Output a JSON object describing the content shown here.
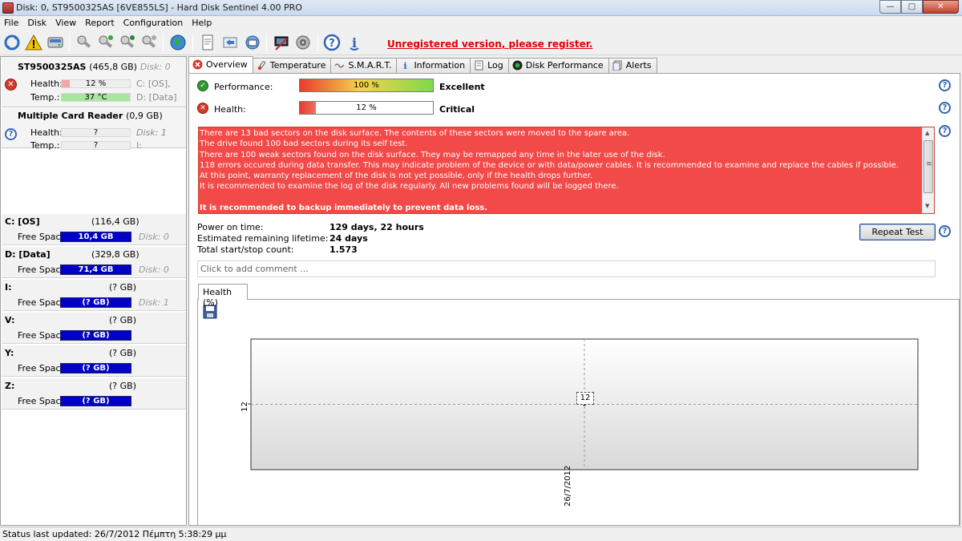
{
  "window": {
    "title": "Disk: 0, ST9500325AS [6VE855LS]  -  Hard Disk Sentinel 4.00 PRO",
    "min_label": "—",
    "max_label": "□",
    "close_label": "✕"
  },
  "menu": [
    "File",
    "Disk",
    "View",
    "Report",
    "Configuration",
    "Help"
  ],
  "toolbar": {
    "register_text": "Unregistered version, please register."
  },
  "disks": [
    {
      "model": "ST9500325AS",
      "size": "(465,8 GB)",
      "disk_no": "Disk: 0",
      "status": "bad",
      "health_label": "Health:",
      "health_value": "12 %",
      "health_fraction": 0.12,
      "health_color": "#f4a6a6",
      "temp_label": "Temp.:",
      "temp_value": "37 °C",
      "temp_color": "#a8e6a0",
      "extra1": "C: [OS],",
      "extra2": "D: [Data]"
    },
    {
      "model": "Multiple Card  Reader",
      "size": "(0,9 GB)",
      "disk_no": "",
      "status": "unknown",
      "health_label": "Health:",
      "health_value": "?",
      "temp_label": "Temp.:",
      "temp_value": "?",
      "extra1": "Disk: 1",
      "extra2": "I:"
    }
  ],
  "volumes": [
    {
      "name": "C: [OS]",
      "size": "(116,4 GB)",
      "free_label": "Free Space",
      "free": "10,4 GB",
      "disk": "Disk: 0",
      "used_fraction": 0.91
    },
    {
      "name": "D: [Data]",
      "size": "(329,8 GB)",
      "free_label": "Free Space",
      "free": "71,4 GB",
      "disk": "Disk: 0",
      "used_fraction": 0.78
    },
    {
      "name": "I:",
      "size": "(? GB)",
      "free_label": "Free Space",
      "free": "(? GB)",
      "disk": "Disk: 1",
      "used_fraction": 1
    },
    {
      "name": "V:",
      "size": "(? GB)",
      "free_label": "Free Space",
      "free": "(? GB)",
      "disk": "",
      "used_fraction": 1
    },
    {
      "name": "Y:",
      "size": "(? GB)",
      "free_label": "Free Space",
      "free": "(? GB)",
      "disk": "",
      "used_fraction": 1
    },
    {
      "name": "Z:",
      "size": "(? GB)",
      "free_label": "Free Space",
      "free": "(? GB)",
      "disk": "",
      "used_fraction": 1
    }
  ],
  "tabs": [
    {
      "label": "Overview",
      "icon": "error-icon",
      "active": true
    },
    {
      "label": "Temperature",
      "icon": "thermometer-icon"
    },
    {
      "label": "S.M.A.R.T.",
      "icon": "smart-icon"
    },
    {
      "label": "Information",
      "icon": "info-icon"
    },
    {
      "label": "Log",
      "icon": "log-icon"
    },
    {
      "label": "Disk Performance",
      "icon": "performance-icon"
    },
    {
      "label": "Alerts",
      "icon": "alerts-icon"
    }
  ],
  "overview": {
    "performance_label": "Performance:",
    "performance_value": "100 %",
    "performance_fraction": 1.0,
    "performance_verdict": "Excellent",
    "health_label": "Health:",
    "health_value": "12 %",
    "health_fraction": 0.12,
    "health_verdict": "Critical",
    "messages": [
      "There are 13 bad sectors on the disk surface. The contents of these sectors were moved to the spare area.",
      "The drive found 100 bad sectors during its self test.",
      "There are 100 weak sectors found on the disk surface. They may be remapped any time in the later use of the disk.",
      "118 errors occured during data transfer. This may indicate problem of the device or with data/power cables. It is recommended to examine and replace the cables if possible.",
      "At this point, warranty replacement of the disk is not yet possible, only if the health drops further.",
      "It is recommended to examine the log of the disk regularly. All new problems found will be logged there.",
      "",
      "It is recommended to backup immediately to prevent data loss."
    ],
    "power_on_label": "Power on time:",
    "power_on_value": "129 days, 22 hours",
    "lifetime_label": "Estimated remaining lifetime:",
    "lifetime_value": "24 days",
    "startstop_label": "Total start/stop count:",
    "startstop_value": "1.573",
    "repeat_test_label": "Repeat Test",
    "comment_placeholder": "Click to add comment ..."
  },
  "chart_tab_label": "Health (%)",
  "chart_data": {
    "type": "line",
    "x": [
      "26/7/2012"
    ],
    "series": [
      {
        "name": "Health (%)",
        "values": [
          12
        ]
      }
    ],
    "ytick_labels": [
      "12"
    ],
    "xtick_labels": [
      "26/7/2012"
    ],
    "data_labels": [
      "12"
    ],
    "grid": true
  },
  "status": {
    "text": "Status last updated: 26/7/2012 Πέμπτη 5:38:29 μμ"
  },
  "colors": {
    "error_red": "#f24a48",
    "volume_blue": "#0000c8",
    "volume_magenta": "#c830c8",
    "link_red": "#e00000"
  }
}
